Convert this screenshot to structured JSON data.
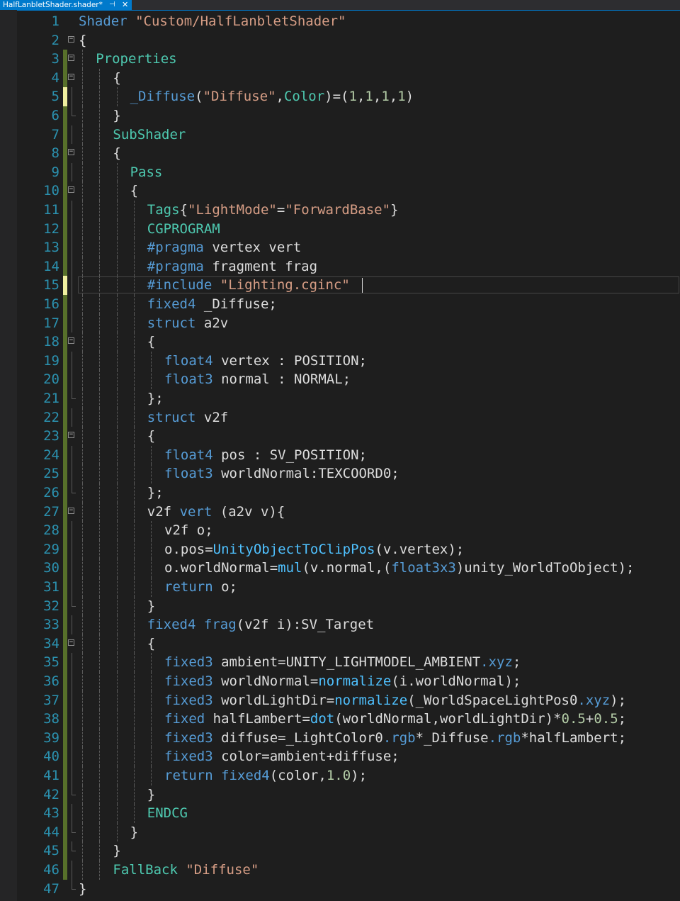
{
  "tab": {
    "title": "HalfLanbletShader.shader*",
    "pin_icon": "⊣",
    "close_icon": "✕"
  },
  "colors": {
    "background": "#1e1e1e",
    "line_number": "#2b91af",
    "keyword": "#569cd6",
    "string": "#d69d85",
    "number": "#b5cea8",
    "function": "#4fc1ff",
    "identifier": "#dcdcdc",
    "semantic": "#4ec9b0",
    "saved_change": "#57702a",
    "unsaved_change": "#efef9f",
    "tab_active": "#007acc"
  },
  "editor": {
    "current_line": 15,
    "lines": [
      {
        "n": "1",
        "indent": 0,
        "fold": "",
        "tokens": [
          [
            "Shader ",
            "kw"
          ],
          [
            "\"Custom/HalfLanbletShader\"",
            "str"
          ]
        ]
      },
      {
        "n": "2",
        "indent": 0,
        "fold": "−",
        "tokens": [
          [
            "{",
            "id"
          ]
        ]
      },
      {
        "n": "3",
        "indent": 1,
        "fold": "−",
        "tokens": [
          [
            "Properties",
            "sem"
          ]
        ]
      },
      {
        "n": "4",
        "indent": 2,
        "fold": "−",
        "tokens": [
          [
            "{",
            "id"
          ]
        ]
      },
      {
        "n": "5",
        "indent": 3,
        "fold": "",
        "tokens": [
          [
            "_Diffuse",
            "kw"
          ],
          [
            "(",
            "id"
          ],
          [
            "\"Diffuse\"",
            "str"
          ],
          [
            ",",
            "id"
          ],
          [
            "Color",
            "sem"
          ],
          [
            ")=(",
            "id"
          ],
          [
            "1",
            "num"
          ],
          [
            ",",
            "id"
          ],
          [
            "1",
            "num"
          ],
          [
            ",",
            "id"
          ],
          [
            "1",
            "num"
          ],
          [
            ",",
            "id"
          ],
          [
            "1",
            "num"
          ],
          [
            ")",
            "id"
          ]
        ]
      },
      {
        "n": "6",
        "indent": 2,
        "fold": "",
        "tokens": [
          [
            "}",
            "id"
          ]
        ]
      },
      {
        "n": "7",
        "indent": 2,
        "fold": "",
        "tokens": [
          [
            "SubShader",
            "sem"
          ]
        ]
      },
      {
        "n": "8",
        "indent": 2,
        "fold": "−",
        "tokens": [
          [
            "{",
            "id"
          ]
        ]
      },
      {
        "n": "9",
        "indent": 3,
        "fold": "",
        "tokens": [
          [
            "Pass",
            "sem"
          ]
        ]
      },
      {
        "n": "10",
        "indent": 3,
        "fold": "−",
        "tokens": [
          [
            "{",
            "id"
          ]
        ]
      },
      {
        "n": "11",
        "indent": 4,
        "fold": "",
        "tokens": [
          [
            "Tags",
            "sem"
          ],
          [
            "{",
            "id"
          ],
          [
            "\"LightMode\"",
            "str"
          ],
          [
            "=",
            "id"
          ],
          [
            "\"ForwardBase\"",
            "str"
          ],
          [
            "}",
            "id"
          ]
        ]
      },
      {
        "n": "12",
        "indent": 4,
        "fold": "",
        "tokens": [
          [
            "CGPROGRAM",
            "sem"
          ]
        ]
      },
      {
        "n": "13",
        "indent": 4,
        "fold": "",
        "tokens": [
          [
            "#pragma",
            "kw"
          ],
          [
            " vertex vert",
            "id"
          ]
        ]
      },
      {
        "n": "14",
        "indent": 4,
        "fold": "",
        "tokens": [
          [
            "#pragma",
            "kw"
          ],
          [
            " fragment frag",
            "id"
          ]
        ]
      },
      {
        "n": "15",
        "indent": 4,
        "fold": "",
        "tokens": [
          [
            "#include",
            "kw"
          ],
          [
            " ",
            "id"
          ],
          [
            "\"Lighting.cginc\"",
            "str"
          ]
        ]
      },
      {
        "n": "16",
        "indent": 4,
        "fold": "",
        "tokens": [
          [
            "fixed4",
            "kw"
          ],
          [
            " _Diffuse;",
            "id"
          ]
        ]
      },
      {
        "n": "17",
        "indent": 4,
        "fold": "",
        "tokens": [
          [
            "struct",
            "kw"
          ],
          [
            " a2v",
            "id"
          ]
        ]
      },
      {
        "n": "18",
        "indent": 4,
        "fold": "−",
        "tokens": [
          [
            "{",
            "id"
          ]
        ]
      },
      {
        "n": "19",
        "indent": 5,
        "fold": "",
        "tokens": [
          [
            "float4",
            "kw"
          ],
          [
            " vertex : POSITION;",
            "id"
          ]
        ]
      },
      {
        "n": "20",
        "indent": 5,
        "fold": "",
        "tokens": [
          [
            "float3",
            "kw"
          ],
          [
            " normal : NORMAL;",
            "id"
          ]
        ]
      },
      {
        "n": "21",
        "indent": 4,
        "fold": "",
        "tokens": [
          [
            "};",
            "id"
          ]
        ]
      },
      {
        "n": "22",
        "indent": 4,
        "fold": "",
        "tokens": [
          [
            "struct",
            "kw"
          ],
          [
            " v2f",
            "id"
          ]
        ]
      },
      {
        "n": "23",
        "indent": 4,
        "fold": "−",
        "tokens": [
          [
            "{",
            "id"
          ]
        ]
      },
      {
        "n": "24",
        "indent": 5,
        "fold": "",
        "tokens": [
          [
            "float4",
            "kw"
          ],
          [
            " pos : SV_POSITION;",
            "id"
          ]
        ]
      },
      {
        "n": "25",
        "indent": 5,
        "fold": "",
        "tokens": [
          [
            "float3",
            "kw"
          ],
          [
            " worldNormal:TEXCOORD0;",
            "id"
          ]
        ]
      },
      {
        "n": "26",
        "indent": 4,
        "fold": "",
        "tokens": [
          [
            "};",
            "id"
          ]
        ]
      },
      {
        "n": "27",
        "indent": 4,
        "fold": "−",
        "tokens": [
          [
            "v2f ",
            "id"
          ],
          [
            "vert",
            "kw"
          ],
          [
            " (a2v v){",
            "id"
          ]
        ]
      },
      {
        "n": "28",
        "indent": 5,
        "fold": "",
        "tokens": [
          [
            "v2f o;",
            "id"
          ]
        ]
      },
      {
        "n": "29",
        "indent": 5,
        "fold": "",
        "tokens": [
          [
            "o.pos=",
            "id"
          ],
          [
            "UnityObjectToClipPos",
            "fn"
          ],
          [
            "(v.vertex);",
            "id"
          ]
        ]
      },
      {
        "n": "30",
        "indent": 5,
        "fold": "",
        "tokens": [
          [
            "o.worldNormal=",
            "id"
          ],
          [
            "mul",
            "fn"
          ],
          [
            "(v.normal,(",
            "id"
          ],
          [
            "float3x3",
            "kw"
          ],
          [
            ")unity_WorldToObject);",
            "id"
          ]
        ]
      },
      {
        "n": "31",
        "indent": 5,
        "fold": "",
        "tokens": [
          [
            "return",
            "kw"
          ],
          [
            " o;",
            "id"
          ]
        ]
      },
      {
        "n": "32",
        "indent": 4,
        "fold": "",
        "tokens": [
          [
            "}",
            "id"
          ]
        ]
      },
      {
        "n": "33",
        "indent": 4,
        "fold": "",
        "tokens": [
          [
            "fixed4",
            "kw"
          ],
          [
            " ",
            "id"
          ],
          [
            "frag",
            "kw"
          ],
          [
            "(v2f i):SV_Target",
            "id"
          ]
        ]
      },
      {
        "n": "34",
        "indent": 4,
        "fold": "−",
        "tokens": [
          [
            "{",
            "id"
          ]
        ]
      },
      {
        "n": "35",
        "indent": 5,
        "fold": "",
        "tokens": [
          [
            "fixed3",
            "kw"
          ],
          [
            " ambient=UNITY_LIGHTMODEL_AMBIENT",
            "id"
          ],
          [
            ".xyz",
            "kw"
          ],
          [
            ";",
            "id"
          ]
        ]
      },
      {
        "n": "36",
        "indent": 5,
        "fold": "",
        "tokens": [
          [
            "fixed3",
            "kw"
          ],
          [
            " worldNormal=",
            "id"
          ],
          [
            "normalize",
            "fn"
          ],
          [
            "(i.worldNormal);",
            "id"
          ]
        ]
      },
      {
        "n": "37",
        "indent": 5,
        "fold": "",
        "tokens": [
          [
            "fixed3",
            "kw"
          ],
          [
            " worldLightDir=",
            "id"
          ],
          [
            "normalize",
            "fn"
          ],
          [
            "(_WorldSpaceLightPos0",
            "id"
          ],
          [
            ".xyz",
            "kw"
          ],
          [
            ");",
            "id"
          ]
        ]
      },
      {
        "n": "38",
        "indent": 5,
        "fold": "",
        "tokens": [
          [
            "fixed",
            "kw"
          ],
          [
            " halfLambert=",
            "id"
          ],
          [
            "dot",
            "fn"
          ],
          [
            "(worldNormal,worldLightDir)*",
            "id"
          ],
          [
            "0.5",
            "num"
          ],
          [
            "+",
            "id"
          ],
          [
            "0.5",
            "num"
          ],
          [
            ";",
            "id"
          ]
        ]
      },
      {
        "n": "39",
        "indent": 5,
        "fold": "",
        "tokens": [
          [
            "fixed3",
            "kw"
          ],
          [
            " diffuse=_LightColor0",
            "id"
          ],
          [
            ".rgb",
            "kw"
          ],
          [
            "*_Diffuse",
            "id"
          ],
          [
            ".rgb",
            "kw"
          ],
          [
            "*halfLambert;",
            "id"
          ]
        ]
      },
      {
        "n": "40",
        "indent": 5,
        "fold": "",
        "tokens": [
          [
            "fixed3",
            "kw"
          ],
          [
            " color=ambient+diffuse;",
            "id"
          ]
        ]
      },
      {
        "n": "41",
        "indent": 5,
        "fold": "",
        "tokens": [
          [
            "return",
            "kw"
          ],
          [
            " ",
            "id"
          ],
          [
            "fixed4",
            "kw"
          ],
          [
            "(color,",
            "id"
          ],
          [
            "1.0",
            "num"
          ],
          [
            ");",
            "id"
          ]
        ]
      },
      {
        "n": "42",
        "indent": 4,
        "fold": "",
        "tokens": [
          [
            "}",
            "id"
          ]
        ]
      },
      {
        "n": "43",
        "indent": 4,
        "fold": "",
        "tokens": [
          [
            "ENDCG",
            "sem"
          ]
        ]
      },
      {
        "n": "44",
        "indent": 3,
        "fold": "",
        "tokens": [
          [
            "}",
            "id"
          ]
        ]
      },
      {
        "n": "45",
        "indent": 2,
        "fold": "",
        "tokens": [
          [
            "}",
            "id"
          ]
        ]
      },
      {
        "n": "46",
        "indent": 2,
        "fold": "",
        "tokens": [
          [
            "FallBack ",
            "sem"
          ],
          [
            "\"Diffuse\"",
            "str"
          ]
        ]
      },
      {
        "n": "47",
        "indent": 0,
        "fold": "",
        "tokens": [
          [
            "}",
            "id"
          ]
        ]
      }
    ]
  }
}
